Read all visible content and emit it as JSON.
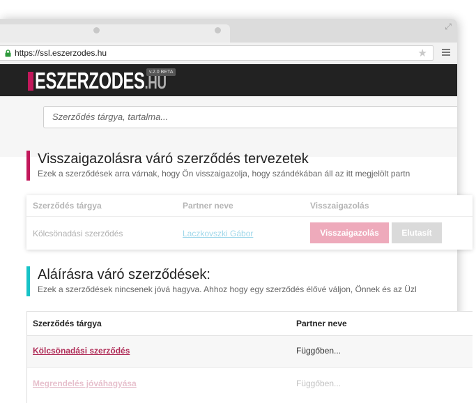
{
  "browser": {
    "url": "https://ssl.eszerzodes.hu"
  },
  "site": {
    "logo_main": "ESZERZODES",
    "logo_suffix": ".HU",
    "version_badge": "v.2.0 BETA"
  },
  "search": {
    "placeholder": "Szerződés tárgya, tartalma..."
  },
  "pending_section": {
    "title": "Visszaigazolásra váró szerződés tervezetek",
    "subtitle": "Ezek a szerződések arra várnak, hogy Ön visszaigazolja, hogy szándékában áll az itt megjelölt partn",
    "accent_color": "#c2185b",
    "columns": [
      "Szerződés tárgya",
      "Partner neve",
      "Visszaigazolás"
    ],
    "rows": [
      {
        "subject": "Kölcsönadási szerződés",
        "partner": "Laczkovszki Gábor",
        "confirm_label": "Visszaigazolás",
        "reject_label": "Elutasít"
      }
    ]
  },
  "signing_section": {
    "title": "Aláírásra váró szerződések:",
    "subtitle": "Ezek a szerződések nincsenek jóvá hagyva. Ahhoz hogy egy szerződés élővé váljon, Önnek és az Üzl",
    "accent_color": "#17c3c7",
    "columns": [
      "Szerződés tárgya",
      "Partner neve"
    ],
    "rows": [
      {
        "subject": "Kölcsönadási szerződés",
        "partner": "Függőben..."
      },
      {
        "subject": "Megrendelés jóváhagyása",
        "partner": "Függőben..."
      }
    ]
  }
}
